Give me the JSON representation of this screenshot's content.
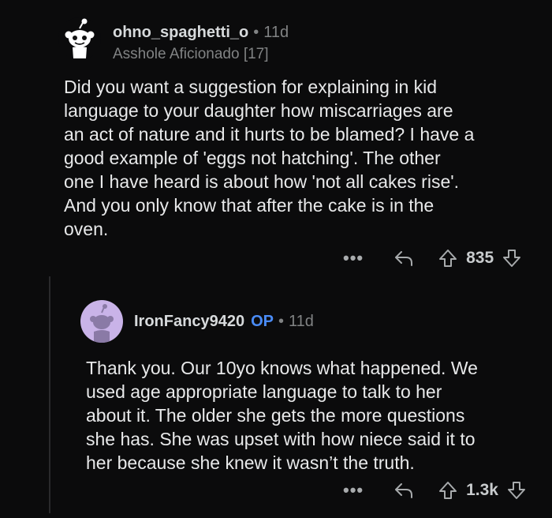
{
  "comments": [
    {
      "username": "ohno_spaghetti_o",
      "separator": "•",
      "age": "11d",
      "flair": "Asshole Aficionado [17]",
      "body_lines": [
        "Did you want a suggestion for explaining in kid",
        "language to your daughter how miscarriages are",
        "an act of nature and it hurts to be blamed? I have a",
        "good example of 'eggs not hatching'. The other",
        "one I have heard is about how 'not all cakes rise'.",
        "And you only know that after the cake is in the",
        "oven."
      ],
      "more_label": "•••",
      "score": "835",
      "avatar_color": "#ffffff"
    },
    {
      "username": "IronFancy9420",
      "op_badge": "OP",
      "separator": "•",
      "age": "11d",
      "body_lines": [
        "Thank you. Our 10yo knows what happened. We",
        "used age appropriate language to talk to her",
        "about it. The older she gets the more questions",
        "she has. She was upset with how niece said it to",
        "her because she knew it wasn’t the truth."
      ],
      "more_label": "•••",
      "score": "1.3k",
      "avatar_color": "#c9b3e8"
    }
  ],
  "colors": {
    "background": "#0b0b0c",
    "muted": "#818384",
    "op_blue": "#4a8cf7"
  }
}
